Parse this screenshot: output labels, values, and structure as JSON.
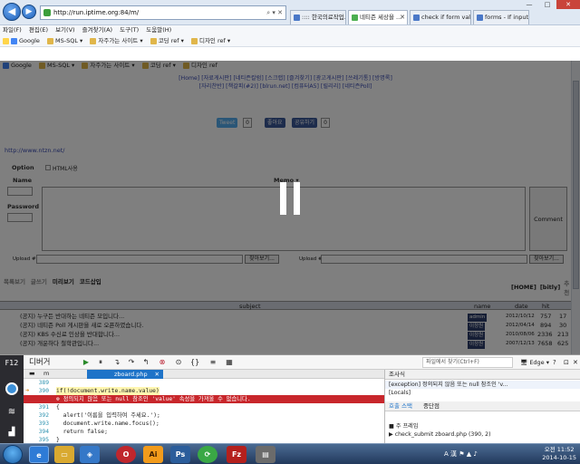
{
  "browser": {
    "address": "http://run.iptime.org:84/m/",
    "tabs": [
      {
        "label": ":::: 한국의료작업..."
      },
      {
        "label": "네티즌 세상을 ..."
      },
      {
        "label": "check if form val..."
      },
      {
        "label": "forms - If input v..."
      }
    ],
    "menu": [
      "파일(F)",
      "편집(E)",
      "보기(V)",
      "즐겨찾기(A)",
      "도구(T)",
      "도움말(H)"
    ],
    "favorites": [
      "Google",
      "MS-SQL ▾",
      "자주가는 사이트 ▾",
      "코딩 ref ▾",
      "디자인 ref ▾"
    ],
    "favorites2": [
      "Google",
      "MS-SQL ▾",
      "자주가는 사이트 ▾",
      "코딩 ref ▾",
      "디자인 ref"
    ]
  },
  "page": {
    "links1": "[Home] [자료게시판] [네티즌칼럼] [스크랩] [즐겨찾기] [광고게시판] [쓰레기통] [방명록]",
    "links2": "[자리찬반] [책갈피(#2)] [blrun.net] [컴퓨터A5] [릴리리] [네티즌Poll]",
    "tweet": "Tweet",
    "tweet_count": "0",
    "like": "좋아요",
    "share": "공유하기",
    "share_count": "0",
    "url": "http://www.ntzn.net/",
    "option": "Option",
    "html_chk": "HTML사용",
    "name": "Name",
    "password": "Password",
    "memo": "Memo ▾",
    "comment": "Comment",
    "upload1": "Upload #1",
    "upload2": "Upload #2",
    "browse": "찾아보기...",
    "tabs": [
      "목록보기",
      "글쓰기",
      "미리보기",
      "코드삽입"
    ],
    "nav_right": [
      "[HOME]",
      "[bitly]",
      "추천"
    ],
    "table_head": [
      "subject",
      "name",
      "date",
      "hit"
    ],
    "rows": [
      {
        "subject": "(공지) 누구든 반대하는 네티즌 모입니다...",
        "name": "admin",
        "date": "2012/10/12",
        "hit": "757",
        "rec": "17"
      },
      {
        "subject": "(공지) 네티즌 Poll 게시판을 새로 오픈하였습니다.",
        "name": "이정원",
        "date": "2012/04/14",
        "hit": "894",
        "rec": "30"
      },
      {
        "subject": "(공지) KBS 수신료 인상을 반대합니다...",
        "name": "이정원",
        "date": "2010/08/06",
        "hit": "2336",
        "rec": "213"
      },
      {
        "subject": "(공지) 개운하다 철학관입니다...",
        "name": "이정원",
        "date": "2007/12/13",
        "hit": "7658",
        "rec": "625"
      }
    ]
  },
  "devtools": {
    "rail_label": "F12",
    "title": "디버거",
    "file": "zboard.php",
    "file_search": "파일에서 찾기(Ctrl+F)",
    "edge": "Edge",
    "code": [
      {
        "ln": "389",
        "tx": ""
      },
      {
        "ln": "390",
        "tx": "if(!document.write.name.value)"
      },
      {
        "ln": "",
        "tx": "⊗ 정의되지 않음 또는 null 참조인 'value' 속성을 가져올 수 없습니다."
      },
      {
        "ln": "391",
        "tx": "{"
      },
      {
        "ln": "392",
        "tx": "  alert('이름을 입력하여 주세요.');"
      },
      {
        "ln": "393",
        "tx": "  document.write.name.focus();"
      },
      {
        "ln": "394",
        "tx": "  return false;"
      },
      {
        "ln": "395",
        "tx": "}"
      }
    ],
    "watch_head": "조사식",
    "watch_rows": [
      "[exception]   정의되지 않음 또는 null 참조인 'v...",
      "[Locals]"
    ],
    "stack_tabs": [
      "호출 스택",
      "중단점"
    ],
    "stack_rows": [
      "■ 주 프레임",
      "  ▶ check_submit                 zboard.php (390, 2)"
    ]
  },
  "taskbar": {
    "time": "오전 11:52",
    "date": "2014-10-15",
    "lang": "A 漢"
  }
}
